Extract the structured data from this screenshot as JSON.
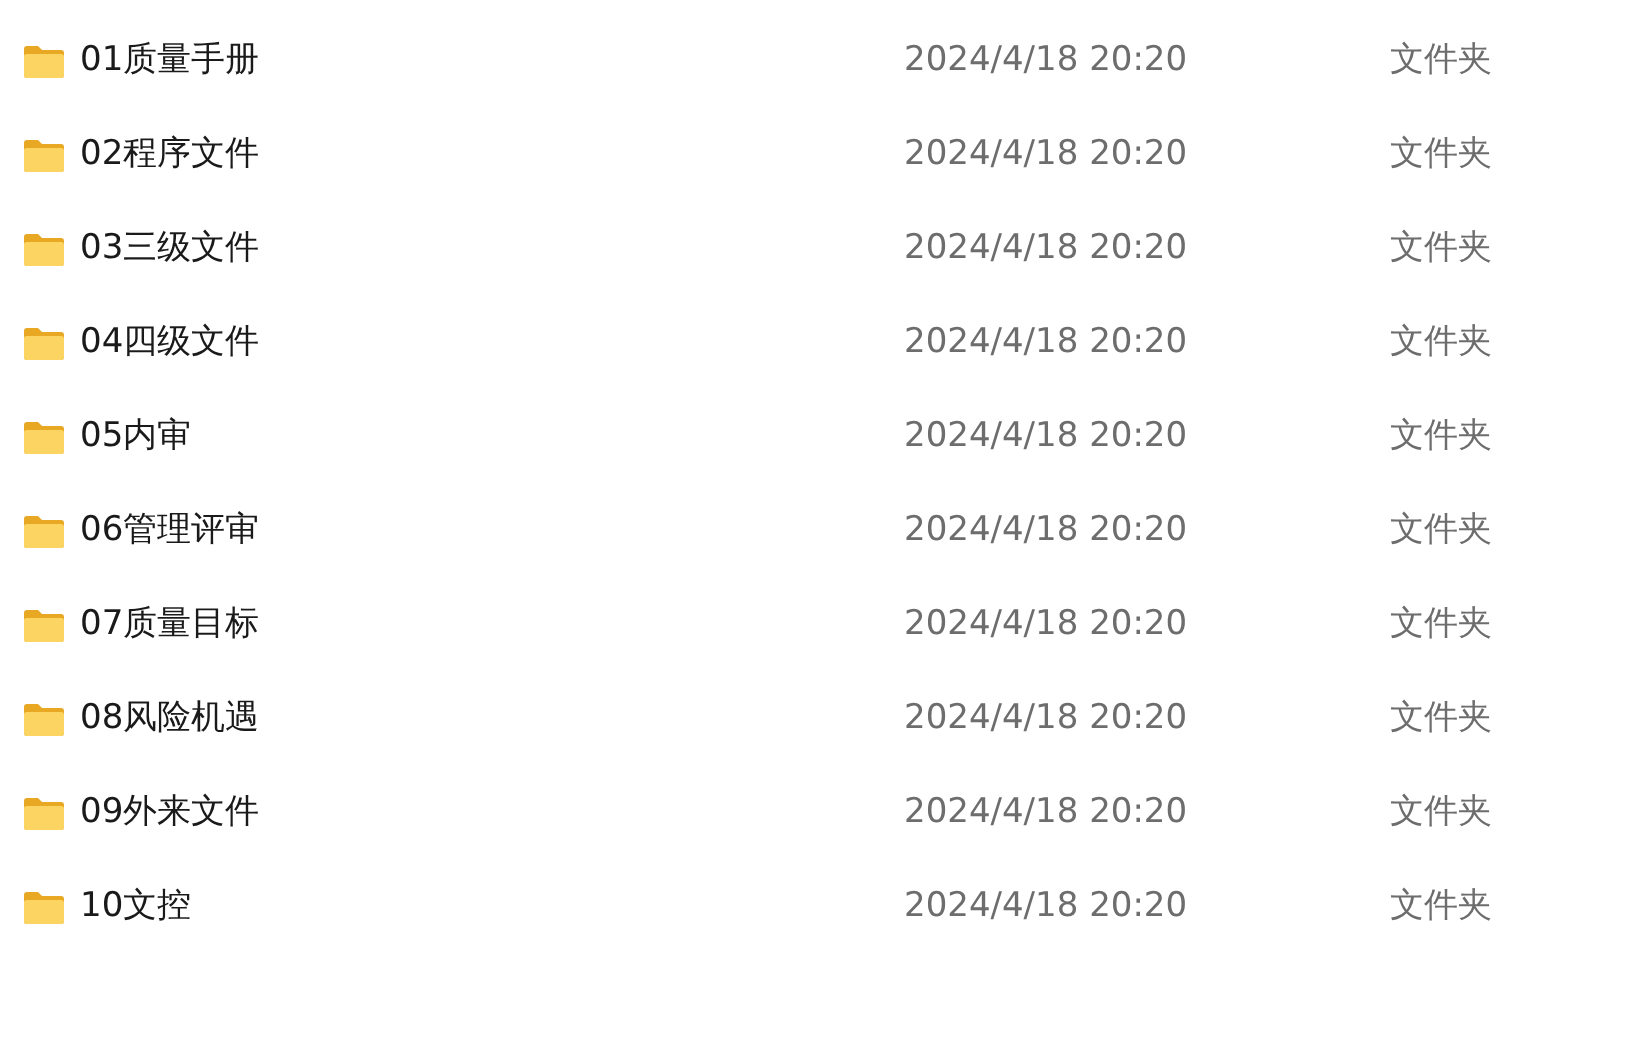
{
  "files": [
    {
      "name": "01质量手册",
      "modified": "2024/4/18 20:20",
      "type": "文件夹"
    },
    {
      "name": "02程序文件",
      "modified": "2024/4/18 20:20",
      "type": "文件夹"
    },
    {
      "name": "03三级文件",
      "modified": "2024/4/18 20:20",
      "type": "文件夹"
    },
    {
      "name": "04四级文件",
      "modified": "2024/4/18 20:20",
      "type": "文件夹"
    },
    {
      "name": "05内审",
      "modified": "2024/4/18 20:20",
      "type": "文件夹"
    },
    {
      "name": "06管理评审",
      "modified": "2024/4/18 20:20",
      "type": "文件夹"
    },
    {
      "name": "07质量目标",
      "modified": "2024/4/18 20:20",
      "type": "文件夹"
    },
    {
      "name": "08风险机遇",
      "modified": "2024/4/18 20:20",
      "type": "文件夹"
    },
    {
      "name": "09外来文件",
      "modified": "2024/4/18 20:20",
      "type": "文件夹"
    },
    {
      "name": "10文控",
      "modified": "2024/4/18 20:20",
      "type": "文件夹"
    }
  ]
}
